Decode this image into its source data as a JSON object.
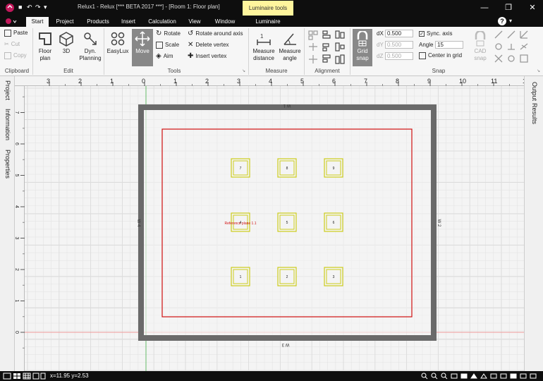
{
  "window": {
    "title": "Relux1 - Relux [*** BETA 2017 ***] - [Room 1: Floor plan]",
    "context_tab": "Luminaire tools",
    "minimize": "—",
    "restore": "❐",
    "close": "✕",
    "help": "?"
  },
  "tabs": [
    {
      "label": "Start"
    },
    {
      "label": "Project"
    },
    {
      "label": "Products"
    },
    {
      "label": "Insert"
    },
    {
      "label": "Calculation"
    },
    {
      "label": "View"
    },
    {
      "label": "Window"
    },
    {
      "label": "Luminaire"
    }
  ],
  "ribbon": {
    "clipboard": {
      "label": "Clipboard",
      "paste": "Paste",
      "cut": "Cut",
      "copy": "Copy"
    },
    "edit": {
      "label": "Edit",
      "floor_plan_1": "Floor",
      "floor_plan_2": "plan",
      "3d": "3D",
      "dyn_1": "Dyn.",
      "dyn_2": "Planning"
    },
    "tools": {
      "label": "Tools",
      "easylux": "EasyLux",
      "move": "Move",
      "rotate": "Rotate",
      "scale": "Scale",
      "aim": "Aim",
      "rotate_axis": "Rotate around axis",
      "delete_vertex": "Delete vertex",
      "insert_vertex": "Insert vertex"
    },
    "measure": {
      "label": "Measure",
      "distance_1": "Measure",
      "distance_2": "distance",
      "angle_1": "Measure",
      "angle_2": "angle"
    },
    "alignment": {
      "label": "Alignment"
    },
    "snap": {
      "label": "Snap",
      "grid_1": "Grid",
      "grid_2": "snap",
      "dx_label": "dX",
      "dx": "0.500",
      "dy_label": "dY",
      "dy": "0.500",
      "dz_label": "dZ",
      "dz": "0.500",
      "sync_axis": "Sync. axis",
      "angle_label": "Angle",
      "angle": "15",
      "center_grid": "Center in grid",
      "cad_1": "CAD",
      "cad_2": "snap"
    }
  },
  "side_tabs": {
    "project": "Project",
    "information": "Information",
    "properties": "Properties",
    "output": "Output",
    "results": "Results"
  },
  "ruler_h": [
    "3",
    "2",
    "1",
    "0",
    "1",
    "2",
    "3",
    "4",
    "5",
    "6",
    "7",
    "8",
    "9",
    "10",
    "11",
    "12"
  ],
  "ruler_v": [
    "12",
    "11",
    "10",
    "9",
    "8",
    "7",
    "6",
    "5",
    "4",
    "3",
    "2",
    "1",
    "0"
  ],
  "room": {
    "wall_top": "W 1",
    "wall_right": "W 2",
    "wall_bottom": "W 3",
    "wall_left": "W 4",
    "ref_plane_label": "Reference plane 1.1"
  },
  "luminaires": [
    {
      "id": "1",
      "col": 0,
      "row": 2
    },
    {
      "id": "2",
      "col": 1,
      "row": 2
    },
    {
      "id": "3",
      "col": 2,
      "row": 2
    },
    {
      "id": "4",
      "col": 0,
      "row": 1
    },
    {
      "id": "5",
      "col": 1,
      "row": 1
    },
    {
      "id": "6",
      "col": 2,
      "row": 1
    },
    {
      "id": "7",
      "col": 0,
      "row": 0
    },
    {
      "id": "8",
      "col": 1,
      "row": 0
    },
    {
      "id": "9",
      "col": 2,
      "row": 0
    }
  ],
  "status": {
    "coords": "x=11.95 y=2.53"
  },
  "colors": {
    "wall": "#6a6a6a",
    "ref_plane": "#d01010",
    "luminaire": "#cccc1a",
    "grid": "#dcdcdc",
    "axis_x": "#ef9a9a",
    "axis_y": "#66bb6a",
    "selection": "#8a8a8a"
  }
}
